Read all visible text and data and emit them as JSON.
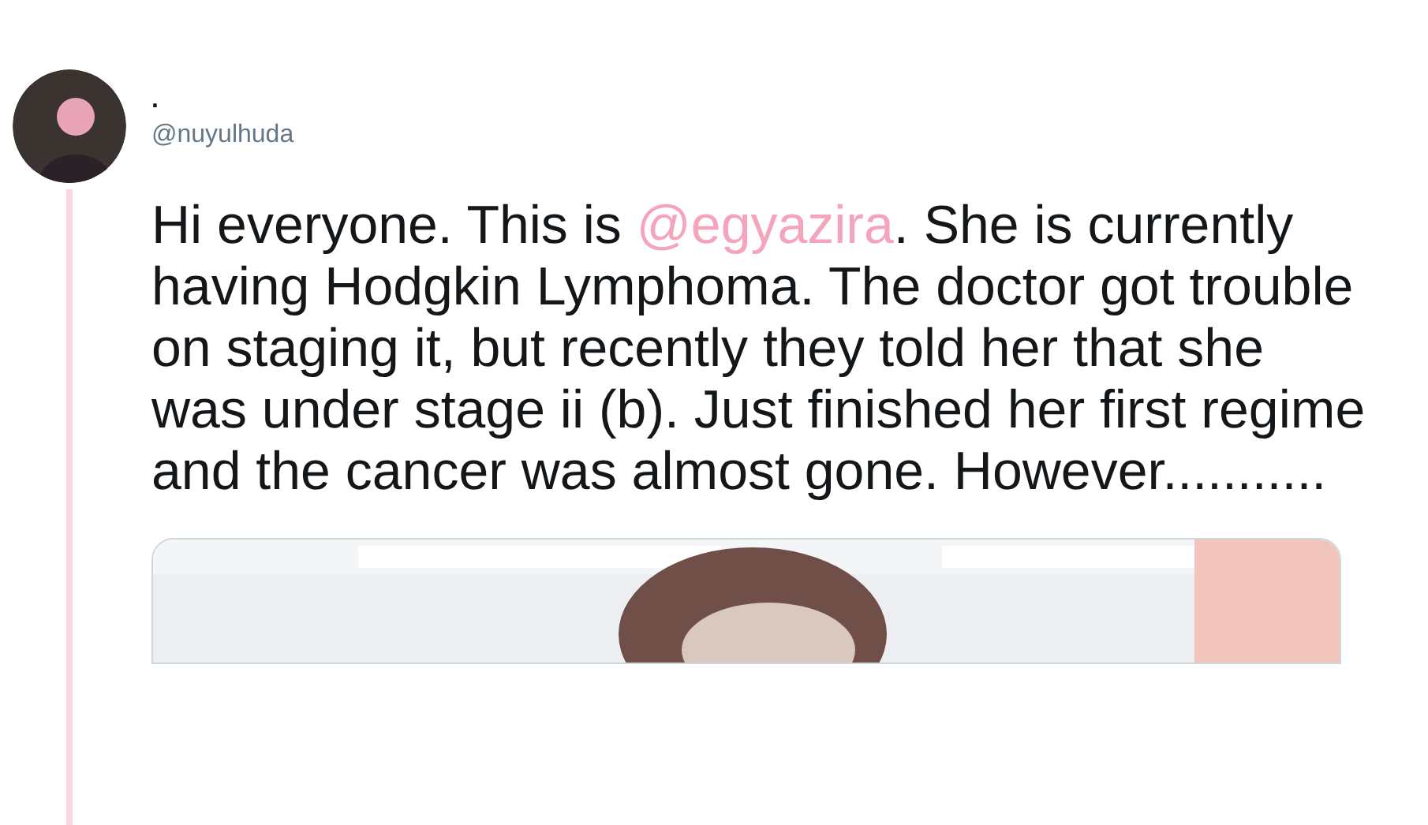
{
  "tweet": {
    "display_name": ".",
    "handle": "@nuyulhuda",
    "text": [
      {
        "kind": "text",
        "text": "Hi everyone. This is "
      },
      {
        "kind": "mention",
        "text": "@egyazira"
      },
      {
        "kind": "text",
        "text": ". She is currently having Hodgkin Lymphoma. The doctor got trouble on staging it, but recently they told her that she was under stage ii (b). Just finished her first regime and the cancer was almost gone. However..........."
      }
    ]
  }
}
